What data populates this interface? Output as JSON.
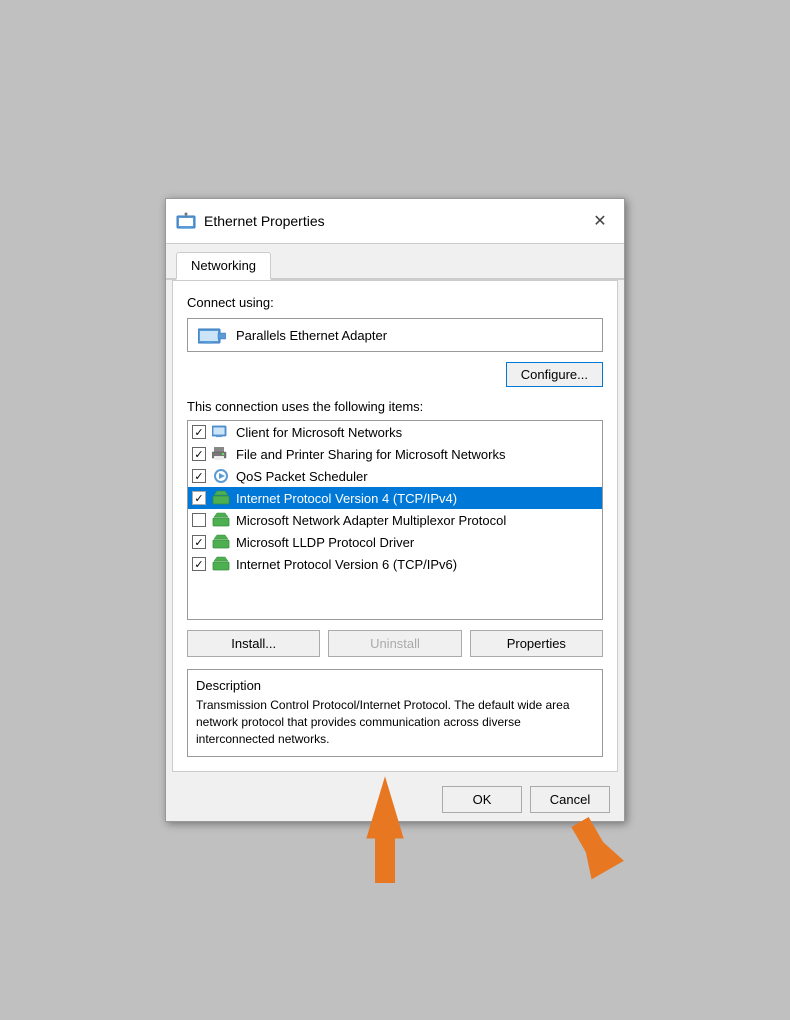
{
  "dialog": {
    "title": "Ethernet Properties",
    "close_label": "✕"
  },
  "tabs": [
    {
      "label": "Networking",
      "active": true
    }
  ],
  "connect_using_label": "Connect using:",
  "adapter": {
    "name": "Parallels Ethernet Adapter"
  },
  "configure_button": "Configure...",
  "items_label": "This connection uses the following items:",
  "items": [
    {
      "checked": true,
      "icon": "network",
      "label": "Client for Microsoft Networks",
      "selected": false
    },
    {
      "checked": true,
      "icon": "printer",
      "label": "File and Printer Sharing for Microsoft Networks",
      "selected": false
    },
    {
      "checked": true,
      "icon": "qos",
      "label": "QoS Packet Scheduler",
      "selected": false
    },
    {
      "checked": true,
      "icon": "tcp",
      "label": "Internet Protocol Version 4 (TCP/IPv4)",
      "selected": true
    },
    {
      "checked": false,
      "icon": "multiplexor",
      "label": "Microsoft Network Adapter Multiplexor Protocol",
      "selected": false
    },
    {
      "checked": true,
      "icon": "lldp",
      "label": "Microsoft LLDP Protocol Driver",
      "selected": false
    },
    {
      "checked": true,
      "icon": "tcp6",
      "label": "Internet Protocol Version 6 (TCP/IPv6)",
      "selected": false
    }
  ],
  "buttons": {
    "install": "Install...",
    "uninstall": "Uninstall",
    "properties": "Properties"
  },
  "description": {
    "title": "Description",
    "text": "Transmission Control Protocol/Internet Protocol. The default wide area network protocol that provides communication across diverse interconnected networks."
  },
  "footer": {
    "ok": "OK",
    "cancel": "Cancel"
  }
}
